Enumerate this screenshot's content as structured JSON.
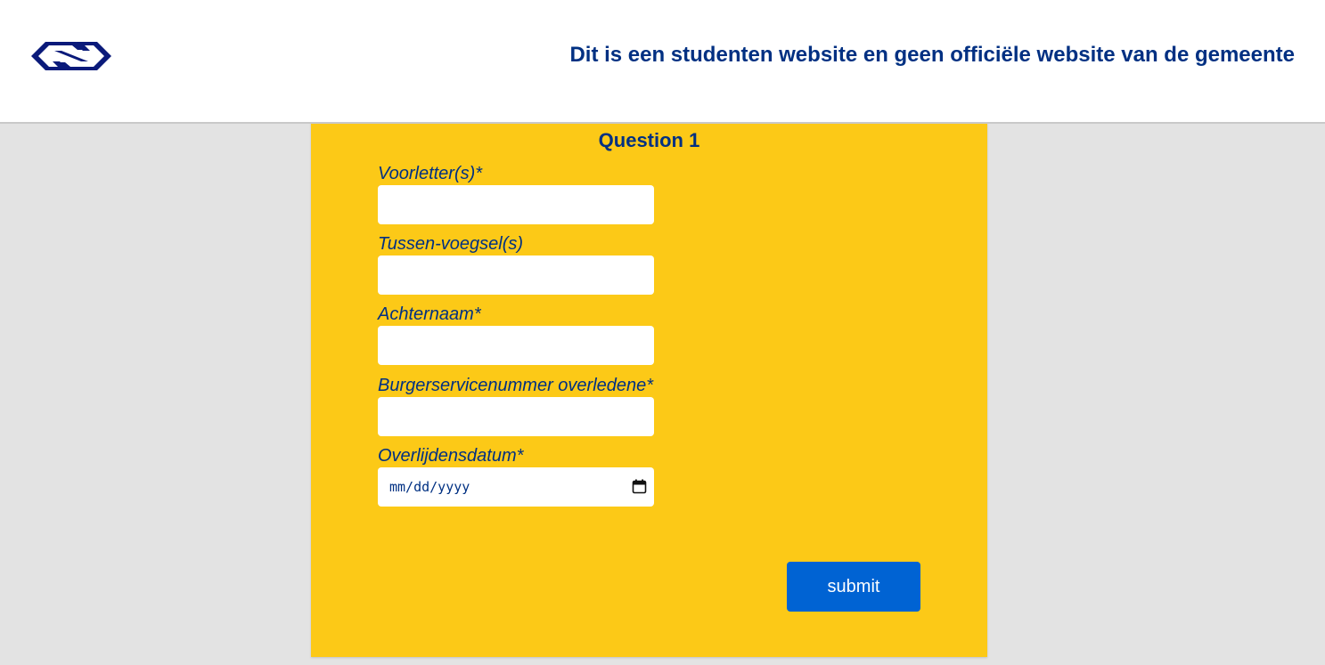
{
  "header": {
    "logo_icon": "ns-logo-icon",
    "disclaimer": "Dit is een studenten website en geen officiële website van de gemeente",
    "brand_color": "#003082"
  },
  "form": {
    "title": "Question 1",
    "background_color": "#fcc917",
    "fields": [
      {
        "label": "Voorletter(s)*",
        "value": ""
      },
      {
        "label": "Tussen-voegsel(s)",
        "value": ""
      },
      {
        "label": "Achternaam*",
        "value": ""
      },
      {
        "label": "Burgerservicenummer overledene*",
        "value": ""
      },
      {
        "label": "Overlijdensdatum*",
        "placeholder": "mm/dd/yyyy",
        "icon": "calendar-icon"
      }
    ],
    "submit_label": "submit",
    "submit_color": "#0063d3"
  }
}
